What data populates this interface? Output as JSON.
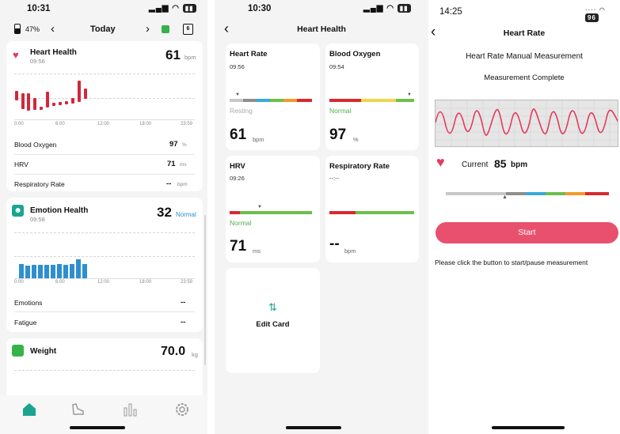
{
  "screen1": {
    "status": {
      "time": "10:31"
    },
    "topbar": {
      "battery": "47%",
      "prev": "‹",
      "date": "Today",
      "next": "›",
      "calendar_day": "6"
    },
    "heart": {
      "title": "Heart Health",
      "time": "09:56",
      "value": "61",
      "unit": "bpm"
    },
    "axis_labels": [
      "0:00",
      "6:00",
      "12:00",
      "18:00",
      "23:59"
    ],
    "metrics": [
      {
        "label": "Blood Oxygen",
        "value": "97",
        "unit": "%"
      },
      {
        "label": "HRV",
        "value": "71",
        "unit": "ms"
      },
      {
        "label": "Respiratory Rate",
        "value": "--",
        "unit": "bpm"
      }
    ],
    "emotion": {
      "title": "Emotion Health",
      "time": "09:58",
      "value": "32",
      "status": "Normal"
    },
    "emotion_axis": [
      "0:00",
      "6:00",
      "12:00",
      "18:00",
      "23:59"
    ],
    "emotion_metrics": [
      {
        "label": "Emotions",
        "value": "--"
      },
      {
        "label": "Fatigue",
        "value": "--"
      }
    ],
    "weight": {
      "title": "Weight",
      "value": "70.0",
      "unit": "kg"
    },
    "tabs": [
      "home-icon",
      "sneaker-icon",
      "stats-icon",
      "settings-icon"
    ]
  },
  "screen2": {
    "status": {
      "time": "10:30"
    },
    "title": "Heart Health",
    "cards": [
      {
        "title": "Heart Rate",
        "time": "09:56",
        "state": "Resting",
        "value": "61",
        "unit": "bpm"
      },
      {
        "title": "Blood Oxygen",
        "time": "09:54",
        "state": "Normal",
        "value": "97",
        "unit": "%"
      },
      {
        "title": "HRV",
        "time": "09:26",
        "state": "Normal",
        "value": "71",
        "unit": "ms"
      },
      {
        "title": "Respiratory Rate",
        "time": "--:--",
        "state": "",
        "value": "--",
        "unit": "bpm"
      }
    ],
    "edit_card": {
      "icon": "⇅",
      "label": "Edit Card"
    }
  },
  "screen3": {
    "status": {
      "time": "14:25",
      "battery": "96"
    },
    "title": "Heart Rate",
    "subtitle": "Heart Rate Manual Measurement",
    "state": "Measurement Complete",
    "current_label": "Current",
    "current_value": "85",
    "current_unit": "bpm",
    "start_button": "Start",
    "hint": "Please click the button to start/pause measurement"
  },
  "colors": {
    "heart_red": "#e5395b",
    "teal": "#1aa58f",
    "normal_green": "#4fae4a",
    "button_pink": "#e8506e",
    "scale": [
      "#c7c7c7",
      "#8e8e8e",
      "#38a9dc",
      "#6cbf4b",
      "#f39a2b",
      "#d8292f"
    ]
  }
}
